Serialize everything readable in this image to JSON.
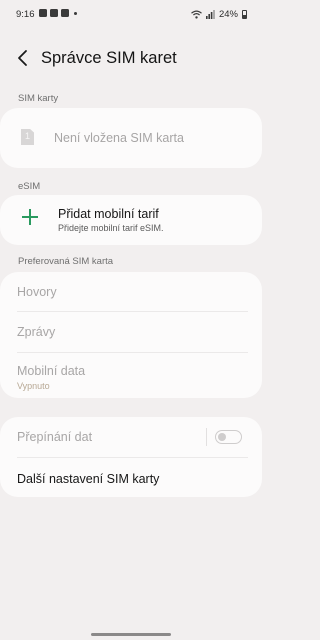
{
  "status_bar": {
    "time": "9:16",
    "battery": "24%",
    "notification_icons": [
      "gallery-icon",
      "youtube-icon",
      "youtube-icon"
    ],
    "indicators": [
      "wifi-icon",
      "signal-icon",
      "battery-icon"
    ]
  },
  "header": {
    "title": "Správce SIM karet",
    "back_icon": "back-arrow-icon"
  },
  "sim_cards": {
    "section_label": "SIM karty",
    "slot_number": "1",
    "empty_label": "Není vložena SIM karta"
  },
  "esim": {
    "section_label": "eSIM",
    "add_title": "Přidat mobilní tarif",
    "add_subtitle": "Přidejte mobilní tarif eSIM."
  },
  "preferred": {
    "section_label": "Preferovaná SIM karta",
    "calls": "Hovory",
    "messages": "Zprávy",
    "mobile_data": "Mobilní data",
    "mobile_data_value": "Vypnuto"
  },
  "more": {
    "data_switching": "Přepínání dat",
    "data_switching_enabled": false,
    "more_settings": "Další nastavení SIM karty"
  },
  "colors": {
    "background": "#f2efef",
    "card": "#fcfbfb",
    "accent": "#2a9a5f"
  }
}
